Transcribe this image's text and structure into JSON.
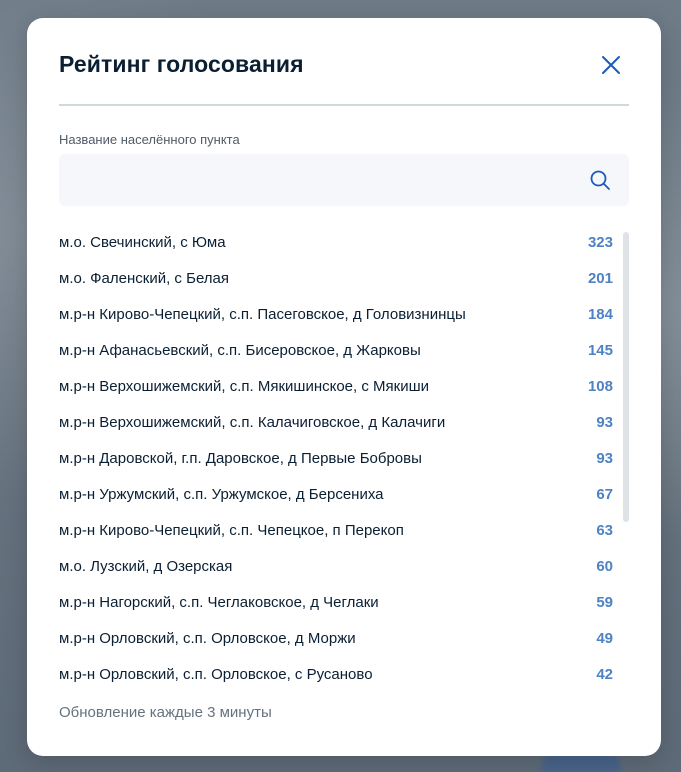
{
  "modal": {
    "title": "Рейтинг голосования",
    "field_label": "Название населённого пункта",
    "search_value": "",
    "search_placeholder": "",
    "footer_note": "Обновление каждые 3 минуты",
    "rows": [
      {
        "name": "м.о. Свечинский, с Юма",
        "count": "323"
      },
      {
        "name": "м.о. Фаленский, с Белая",
        "count": "201"
      },
      {
        "name": "м.р-н Кирово-Чепецкий, с.п. Пасеговское, д Головизнинцы",
        "count": "184"
      },
      {
        "name": "м.р-н Афанасьевский, с.п. Бисеровское, д Жарковы",
        "count": "145"
      },
      {
        "name": "м.р-н Верхошижемский, с.п. Мякишинское, с Мякиши",
        "count": "108"
      },
      {
        "name": "м.р-н Верхошижемский, с.п. Калачиговское, д Калачиги",
        "count": "93"
      },
      {
        "name": "м.р-н Даровской, г.п. Даровское, д Первые Бобровы",
        "count": "93"
      },
      {
        "name": "м.р-н Уржумский, с.п. Уржумское, д Берсениха",
        "count": "67"
      },
      {
        "name": "м.р-н Кирово-Чепецкий, с.п. Чепецкое, п Перекоп",
        "count": "63"
      },
      {
        "name": "м.о. Лузский, д Озерская",
        "count": "60"
      },
      {
        "name": "м.р-н Нагорский, с.п. Чеглаковское, д Чеглаки",
        "count": "59"
      },
      {
        "name": "м.р-н Орловский, с.п. Орловское, д Моржи",
        "count": "49"
      },
      {
        "name": "м.р-н Орловский, с.п. Орловское, с Русаново",
        "count": "42"
      }
    ]
  },
  "colors": {
    "title": "#0b1f33",
    "accent_count": "#4d82c4",
    "close_icon": "#1b5bbd"
  },
  "icons": {
    "close": "close-icon",
    "search": "search-icon"
  }
}
